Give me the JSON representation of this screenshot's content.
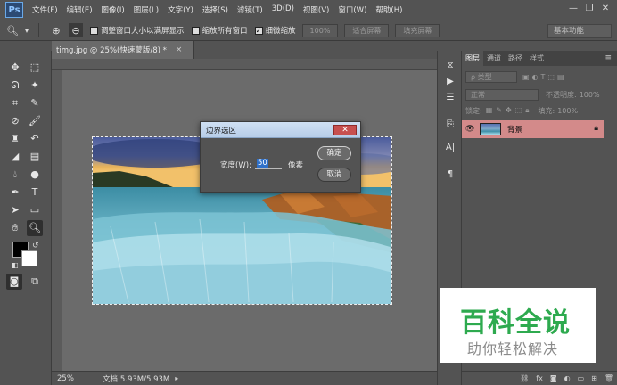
{
  "app": {
    "logo": "Ps"
  },
  "menu": [
    "文件(F)",
    "编辑(E)",
    "图像(I)",
    "图层(L)",
    "文字(Y)",
    "选择(S)",
    "滤镜(T)",
    "3D(D)",
    "视图(V)",
    "窗口(W)",
    "帮助(H)"
  ],
  "window_controls": {
    "minimize": "—",
    "restore": "❐",
    "close": "✕"
  },
  "options": {
    "tool_icon": "zoom-icon",
    "resize_windows_label": "调整窗口大小以满屏显示",
    "zoom_all_windows_label": "缩放所有窗口",
    "scrubby_zoom_label": "细微缩放",
    "scrubby_zoom_checked": true,
    "zoom_percent": "100%",
    "fit_screen": "适合屏幕",
    "fill_screen": "填充屏幕",
    "workspace": "基本功能"
  },
  "document": {
    "tab_title": "timg.jpg @ 25%(快速蒙版/8) *",
    "tab_close": "×",
    "zoom": "25%",
    "doc_info": "文档:5.93M/5.93M",
    "status_arrow": "▸"
  },
  "dialog": {
    "title": "边界选区",
    "close": "✕",
    "width_label": "宽度(W):",
    "width_value": "50",
    "unit": "像素",
    "ok": "确定",
    "cancel": "取消"
  },
  "layers_panel": {
    "tabs": [
      "图层",
      "通道",
      "路径",
      "样式"
    ],
    "menu_icon": "≡",
    "filter_kind": "ρ 类型",
    "blend_mode": "正常",
    "opacity_label": "不透明度:",
    "opacity_value": "100%",
    "lock_label": "锁定:",
    "fill_label": "填充:",
    "fill_value": "100%",
    "layers": [
      {
        "name": "背景",
        "visible": true,
        "locked": true
      }
    ],
    "footer_icons": [
      "link-icon",
      "fx-icon",
      "mask-icon",
      "adjustment-icon",
      "group-icon",
      "new-layer-icon",
      "trash-icon"
    ],
    "fx_label": "fx"
  },
  "watermark": {
    "title": "百科全说",
    "subtitle": "助你轻松解决"
  },
  "colors": {
    "layer_highlight": "#d38a8a",
    "ui_background": "#535353",
    "watermark_green": "#2eaa4f"
  }
}
